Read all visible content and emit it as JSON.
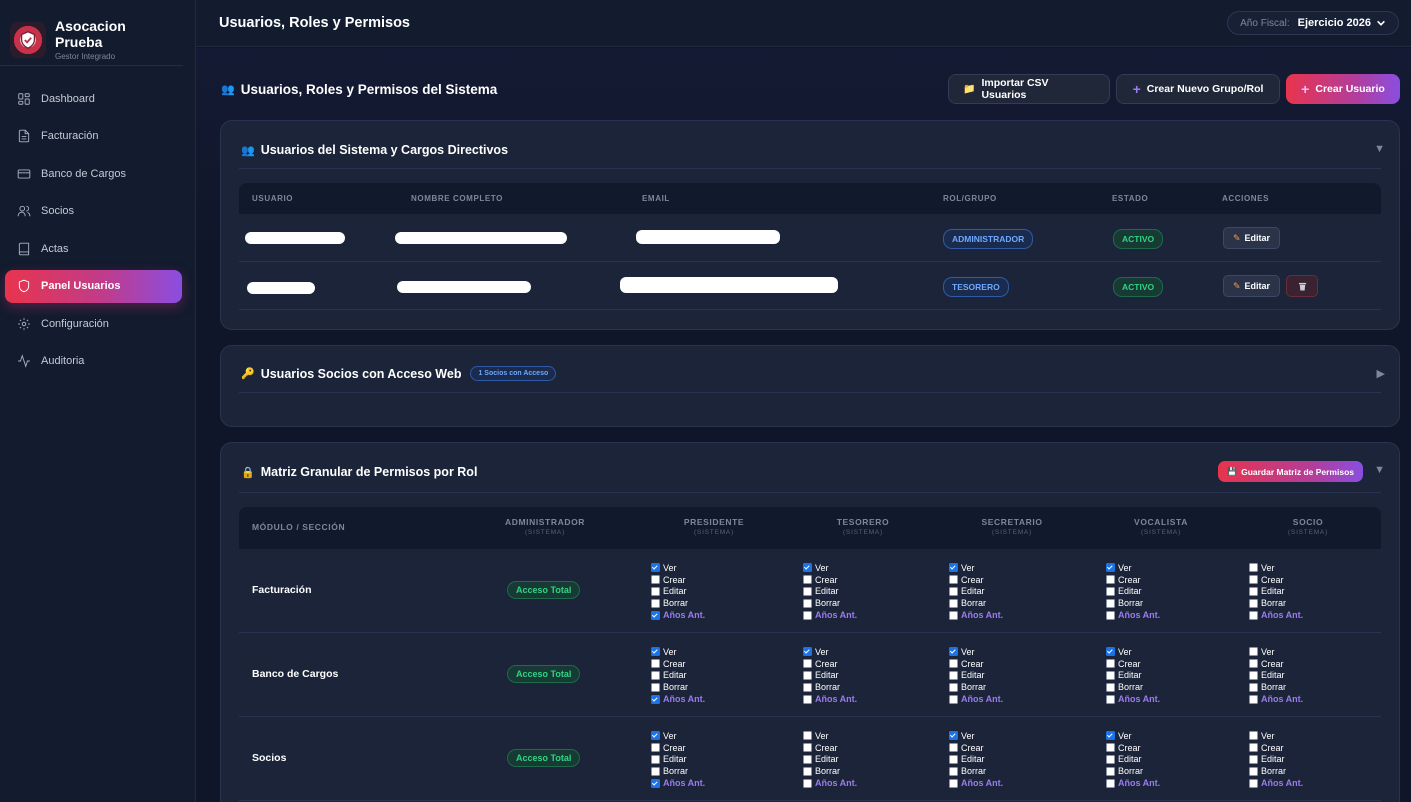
{
  "brand": {
    "name": "Asocacion Prueba",
    "subtitle": "Gestor Integrado"
  },
  "nav": [
    {
      "label": "Dashboard",
      "icon": "grid-icon"
    },
    {
      "label": "Facturación",
      "icon": "file-icon"
    },
    {
      "label": "Banco de Cargos",
      "icon": "credit-card-icon"
    },
    {
      "label": "Socios",
      "icon": "users-icon"
    },
    {
      "label": "Actas",
      "icon": "book-icon"
    },
    {
      "label": "Panel Usuarios",
      "icon": "shield-icon",
      "active": true
    },
    {
      "label": "Configuración",
      "icon": "gear-icon"
    },
    {
      "label": "Auditoria",
      "icon": "activity-icon"
    }
  ],
  "topbar": {
    "title": "Usuarios, Roles y Permisos",
    "fiscal_label": "Año Fiscal:",
    "fiscal_value": "Ejercicio 2026"
  },
  "main": {
    "section_title": "Usuarios, Roles y Permisos del Sistema",
    "btn_import": "Importar CSV Usuarios",
    "btn_group": "Crear Nuevo Grupo/Rol",
    "btn_user": "Crear Usuario"
  },
  "users_card": {
    "title": "Usuarios del Sistema y Cargos Directivos",
    "columns": [
      "USUARIO",
      "NOMBRE COMPLETO",
      "EMAIL",
      "ROL/GRUPO",
      "ESTADO",
      "ACCIONES"
    ],
    "rows": [
      {
        "role": "ADMINISTRADOR",
        "status": "ACTIVO",
        "edit": "Editar"
      },
      {
        "role": "TESORERO",
        "status": "ACTIVO",
        "edit": "Editar"
      }
    ]
  },
  "web_card": {
    "title": "Usuarios Socios con Acceso Web",
    "badge": "1 Socios con Acceso"
  },
  "matrix_card": {
    "title": "Matriz Granular de Permisos por Rol",
    "save": "Guardar Matriz de Permisos",
    "first_col": "MÓDULO / SECCIÓN",
    "roles": [
      {
        "name": "ADMINISTRADOR",
        "sub": "(SISTEMA)"
      },
      {
        "name": "PRESIDENTE",
        "sub": "(SISTEMA)"
      },
      {
        "name": "TESORERO",
        "sub": "(SISTEMA)"
      },
      {
        "name": "SECRETARIO",
        "sub": "(SISTEMA)"
      },
      {
        "name": "VOCALISTA",
        "sub": "(SISTEMA)"
      },
      {
        "name": "SOCIO",
        "sub": "(SISTEMA)"
      }
    ],
    "perm_labels": [
      "Ver",
      "Crear",
      "Editar",
      "Borrar",
      "Años Ant."
    ],
    "full_access": "Acceso Total",
    "modules": [
      {
        "name": "Facturación",
        "checks": [
          [
            true,
            false,
            false,
            false,
            true
          ],
          [
            true,
            false,
            false,
            false,
            false
          ],
          [
            true,
            false,
            false,
            false,
            false
          ],
          [
            true,
            false,
            false,
            false,
            false
          ],
          [
            false,
            false,
            false,
            false,
            false
          ]
        ]
      },
      {
        "name": "Banco de Cargos",
        "checks": [
          [
            true,
            false,
            false,
            false,
            true
          ],
          [
            true,
            false,
            false,
            false,
            false
          ],
          [
            true,
            false,
            false,
            false,
            false
          ],
          [
            true,
            false,
            false,
            false,
            false
          ],
          [
            false,
            false,
            false,
            false,
            false
          ]
        ]
      },
      {
        "name": "Socios",
        "checks": [
          [
            true,
            false,
            false,
            false,
            true
          ],
          [
            false,
            false,
            false,
            false,
            false
          ],
          [
            true,
            false,
            false,
            false,
            false
          ],
          [
            true,
            false,
            false,
            false,
            false
          ],
          [
            false,
            false,
            false,
            false,
            false
          ]
        ]
      }
    ]
  }
}
